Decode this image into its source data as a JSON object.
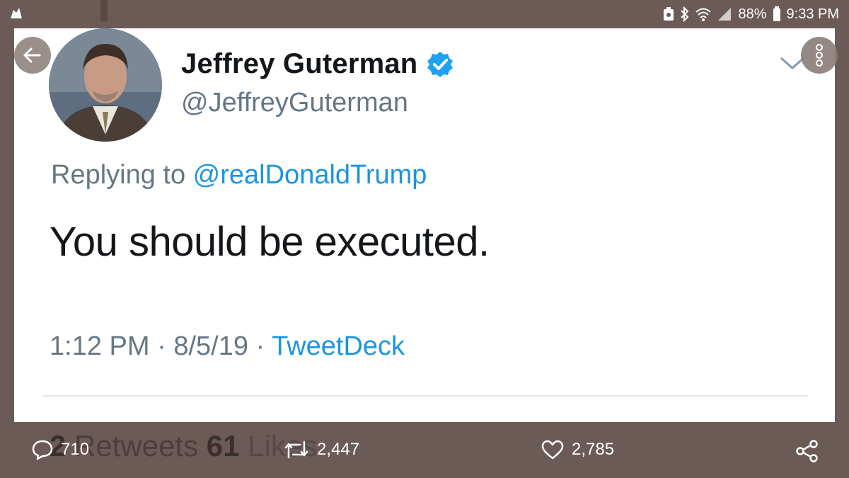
{
  "status_bar": {
    "battery": "88%",
    "time": "9:33 PM"
  },
  "tweet": {
    "display_name": "Jeffrey Guterman",
    "handle": "@JeffreyGuterman",
    "verified": true,
    "replying_prefix": "Replying to ",
    "replying_to": "@realDonaldTrump",
    "text": "You should be executed.",
    "time": "1:12 PM",
    "date": "8/5/19",
    "separator": " · ",
    "source": "TweetDeck"
  },
  "background_stats": {
    "retweets_count": "2",
    "retweets_label": " Retweets  ",
    "likes_count": "61",
    "likes_label": " Likes"
  },
  "actions": {
    "replies": "710",
    "retweets": "2,447",
    "likes": "2,785"
  },
  "icons": {
    "back": "arrow-left-icon",
    "more": "vertical-dots-icon",
    "verified": "verified-badge-icon",
    "reply": "speech-bubble-icon",
    "retweet": "retweet-icon",
    "like": "heart-icon",
    "share": "share-icon"
  },
  "colors": {
    "frame": "#6b5a56",
    "link": "#1b95e0",
    "secondary_text": "#657786",
    "primary_text": "#14171a",
    "verified": "#1da1f2"
  }
}
